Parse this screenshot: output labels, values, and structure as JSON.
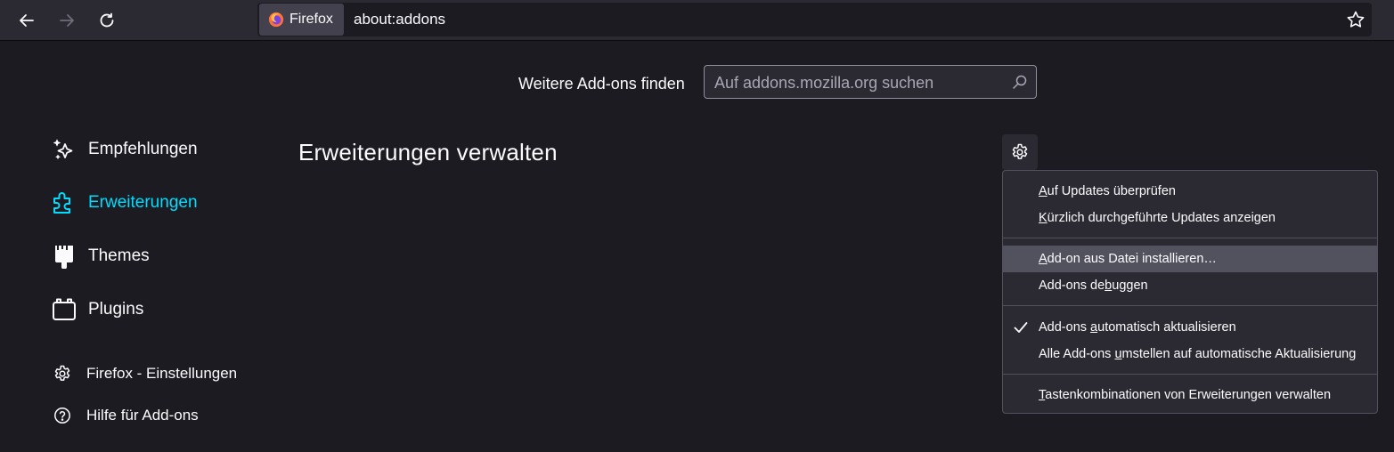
{
  "toolbar": {
    "identity_label": "Firefox",
    "url": "about:addons"
  },
  "search": {
    "label": "Weitere Add-ons finden",
    "placeholder": "Auf addons.mozilla.org suchen"
  },
  "sidebar": {
    "categories": [
      {
        "label": "Empfehlungen",
        "icon": "sparkle-icon",
        "active": false
      },
      {
        "label": "Erweiterungen",
        "icon": "puzzle-icon",
        "active": true
      },
      {
        "label": "Themes",
        "icon": "brush-icon",
        "active": false
      },
      {
        "label": "Plugins",
        "icon": "plugin-icon",
        "active": false
      }
    ],
    "footer": [
      {
        "label": "Firefox - Einstellungen",
        "icon": "gear-icon"
      },
      {
        "label": "Hilfe für Add-ons",
        "icon": "help-icon"
      }
    ]
  },
  "main": {
    "heading": "Erweiterungen verwalten"
  },
  "menu": {
    "items": [
      {
        "key": "A",
        "rest": "uf Updates überprüfen"
      },
      {
        "key": "K",
        "rest": "ürzlich durchgeführte Updates anzeigen"
      },
      {
        "key": "A",
        "rest": "dd-on aus Datei installieren…"
      },
      {
        "pre": "Add-ons de",
        "key": "b",
        "rest": "uggen"
      },
      {
        "pre": "Add-ons ",
        "key": "a",
        "rest": "utomatisch aktualisieren",
        "checked": true
      },
      {
        "pre": "Alle Add-ons ",
        "key": "u",
        "rest": "mstellen auf automatische Aktualisierung"
      },
      {
        "key": "T",
        "rest": "astenkombinationen von Erweiterungen verwalten"
      }
    ]
  },
  "colors": {
    "background": "#1c1b22",
    "toolbar": "#2b2a33",
    "accent": "#00ddff",
    "text": "#fbfbfe",
    "menu_hover": "#52525e"
  }
}
